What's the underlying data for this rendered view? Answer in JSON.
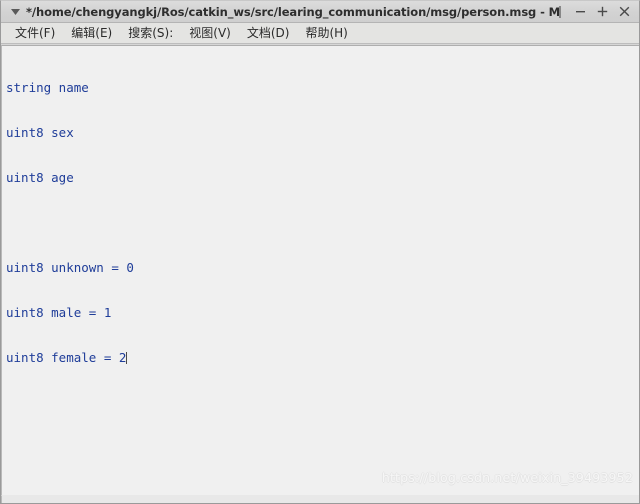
{
  "window": {
    "title": "*/home/chengyangkj/Ros/catkin_ws/src/learing_communication/msg/person.msg - Mouse",
    "menu_arrow_icon": "chevron-down-icon",
    "controls": {
      "minimize_label": "−",
      "maximize_label": "+",
      "close_label": "✕"
    }
  },
  "menubar": {
    "items": [
      {
        "label": "文件(F)"
      },
      {
        "label": "编辑(E)"
      },
      {
        "label": "搜索(S):"
      },
      {
        "label": "视图(V)"
      },
      {
        "label": "文档(D)"
      },
      {
        "label": "帮助(H)"
      }
    ]
  },
  "editor": {
    "text_color": "#1f3d99",
    "background": "#f0f0f0",
    "lines": [
      "string name",
      "uint8 sex",
      "uint8 age",
      "",
      "uint8 unknown = 0",
      "uint8 male = 1",
      "uint8 female = 2"
    ]
  },
  "watermark": {
    "text": "https://blog.csdn.net/weixin_39493952"
  }
}
